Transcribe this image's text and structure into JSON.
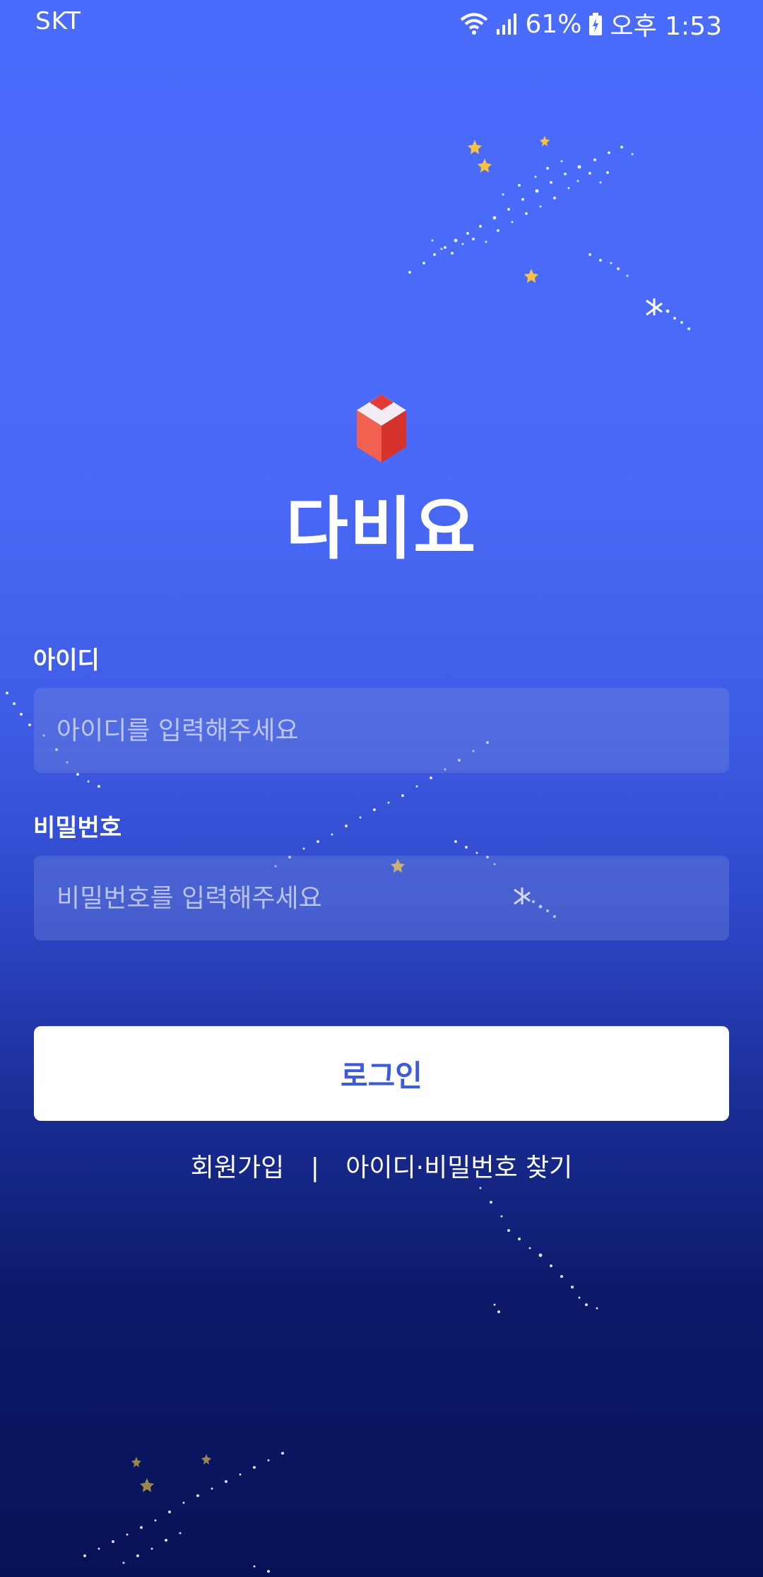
{
  "status_bar": {
    "carrier": "SKT",
    "battery": "61%",
    "time": "오후 1:53",
    "icons": [
      "wifi-icon",
      "signal-icon",
      "battery-icon"
    ]
  },
  "app": {
    "name": "다비요",
    "logo": "cube-logo-icon"
  },
  "form": {
    "id_label": "아이디",
    "id_placeholder": "아이디를 입력해주세요",
    "password_label": "비밀번호",
    "password_placeholder": "비밀번호를 입력해주세요",
    "login_label": "로그인"
  },
  "links": {
    "signup": "회원가입",
    "separator": "|",
    "find": "아이디·비밀번호 찾기"
  },
  "colors": {
    "background_top": "#4a6cfc",
    "background_bottom": "#071256",
    "button_text": "#3d5ad9",
    "star": "#f5c242"
  }
}
